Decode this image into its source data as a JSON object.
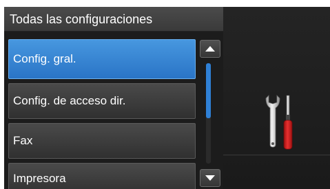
{
  "header": {
    "title": "Todas las configuraciones"
  },
  "menu": {
    "items": [
      {
        "label": "Config. gral.",
        "selected": true
      },
      {
        "label": "Config. de acceso dir.",
        "selected": false
      },
      {
        "label": "Fax",
        "selected": false
      },
      {
        "label": "Impresora",
        "selected": false
      }
    ]
  },
  "scroll": {
    "position_fraction": 0.0,
    "visible_fraction": 0.55
  },
  "icons": {
    "scroll_up": "triangle-up-icon",
    "scroll_down": "triangle-down-icon",
    "settings": "wrench-screwdriver-icon"
  },
  "colors": {
    "selected": "#2f80d6",
    "background": "#1c1c1c",
    "screwdriver_handle": "#d42020"
  }
}
